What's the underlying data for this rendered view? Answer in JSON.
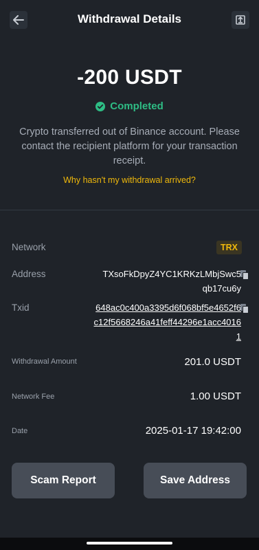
{
  "header": {
    "title": "Withdrawal Details",
    "back_icon": "arrow-left-icon",
    "share_icon": "share-export-icon"
  },
  "summary": {
    "amount": "-200 USDT",
    "status": "Completed",
    "status_color": "#2ebd85",
    "description": "Crypto transferred out of Binance account. Please contact the recipient platform for your transaction receipt.",
    "help_link": "Why hasn't my withdrawal arrived?",
    "help_color": "#f0b90b"
  },
  "details": {
    "network_label": "Network",
    "network_value": "TRX",
    "address_label": "Address",
    "address_value": "TXsoFkDpyZ4YC1KRKzLMbjSwc5qb17cu6y",
    "txid_label": "Txid",
    "txid_value": "648ac0c400a3395d6f068bf5e4652f6c12f5668246a41feff44296e1acc40161",
    "amount_label": "Withdrawal Amount",
    "amount_value": "201.0 USDT",
    "fee_label": "Network Fee",
    "fee_value": "1.00 USDT",
    "date_label": "Date",
    "date_value": "2025-01-17 19:42:00"
  },
  "actions": {
    "scam_report": "Scam Report",
    "save_address": "Save Address"
  }
}
